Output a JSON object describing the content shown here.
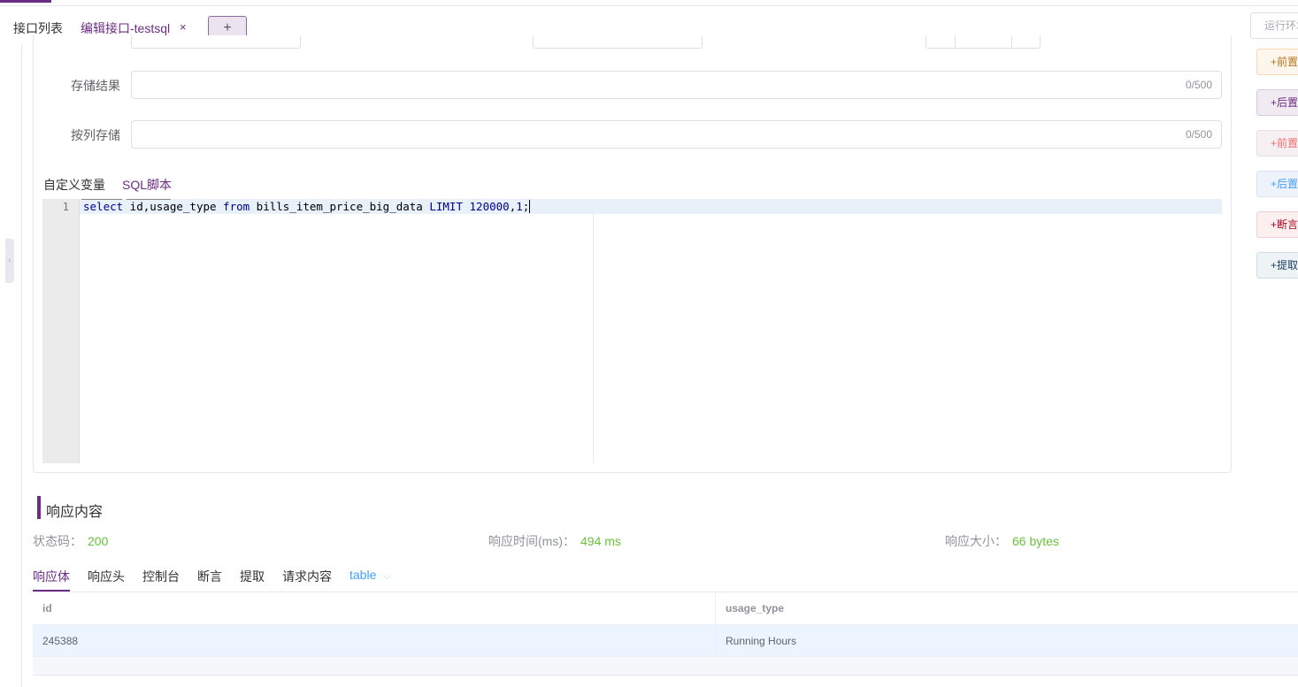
{
  "tabs": {
    "api_list": "接口列表",
    "edit_api": "编辑接口-testsql",
    "close": "×",
    "add": "+"
  },
  "env_button": "运行环境",
  "collapse_icon": "‹",
  "form": {
    "store_result": {
      "label": "存储结果",
      "counter": "0/500",
      "value": ""
    },
    "store_by_column": {
      "label": "按列存储",
      "counter": "0/500",
      "value": ""
    }
  },
  "sub_tabs": {
    "custom_vars": "自定义变量",
    "sql_script": "SQL脚本"
  },
  "editor": {
    "line_number": "1",
    "tokens": [
      {
        "text": "select",
        "kw": true
      },
      {
        "text": " id,usage_type ",
        "kw": false
      },
      {
        "text": "from",
        "kw": true
      },
      {
        "text": " bills_item_price_big_data ",
        "kw": false
      },
      {
        "text": "LIMIT",
        "kw": true
      },
      {
        "text": " ",
        "kw": false
      },
      {
        "text": "120000",
        "kw": true
      },
      {
        "text": ",",
        "kw": false
      },
      {
        "text": "1",
        "kw": true
      },
      {
        "text": ";",
        "kw": false
      }
    ]
  },
  "side_actions": [
    {
      "label": "+前置脚本",
      "color": "#b8741a",
      "bg": "#fdf6ec",
      "border": "#f5dab1"
    },
    {
      "label": "+后置脚本",
      "color": "#6b2c83",
      "bg": "#f0ebf3",
      "border": "#d9c9e0"
    },
    {
      "label": "+前置SQL",
      "color": "#f56c6c",
      "bg": "#f7f0f3",
      "border": "#e8dde2"
    },
    {
      "label": "+后置SQL",
      "color": "#409eff",
      "bg": "#eef3fb",
      "border": "#d9e4f3"
    },
    {
      "label": "+断言",
      "color": "#a8071a",
      "bg": "#fbeff0",
      "border": "#f0d0d4"
    },
    {
      "label": "+提取",
      "color": "#1f3f66",
      "bg": "#eef3f6",
      "border": "#d3dde5"
    }
  ],
  "response": {
    "title": "响应内容",
    "status_label": "状态码：",
    "status_value": "200",
    "time_label": "响应时间(ms)：",
    "time_value": "494 ms",
    "size_label": "响应大小：",
    "size_value": "66 bytes",
    "tabs": [
      "响应体",
      "响应头",
      "控制台",
      "断言",
      "提取",
      "请求内容"
    ],
    "format_select": "table",
    "chevron": "⌵",
    "table": {
      "columns": [
        "id",
        "usage_type"
      ],
      "rows": [
        [
          "245388",
          "Running Hours"
        ]
      ]
    }
  }
}
